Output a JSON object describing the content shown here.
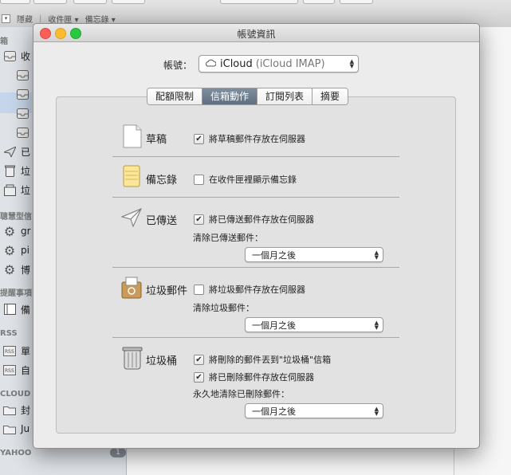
{
  "background": {
    "favorites": [
      "隱藏",
      "收件匣",
      "備忘錄"
    ],
    "sidebar": {
      "items": [
        {
          "label": "箱",
          "kind": "header"
        },
        {
          "label": "收",
          "icon": "inbox-icon"
        },
        {
          "label": "",
          "icon": "inbox-icon"
        },
        {
          "label": "",
          "icon": "inbox-icon"
        },
        {
          "label": "",
          "icon": "inbox-icon"
        },
        {
          "label": "",
          "icon": "inbox-icon"
        },
        {
          "label": "已",
          "icon": "paper-plane-icon"
        },
        {
          "label": "垃",
          "icon": "trash-icon"
        },
        {
          "label": "垃",
          "icon": "junk-icon"
        },
        {
          "label": "聰慧型信",
          "kind": "header"
        },
        {
          "label": "gr",
          "icon": "gear-icon"
        },
        {
          "label": "pi",
          "icon": "gear-icon"
        },
        {
          "label": "博",
          "icon": "gear-icon"
        },
        {
          "label": "提醒事項",
          "kind": "header"
        },
        {
          "label": "備",
          "icon": "notes-icon"
        },
        {
          "label": "RSS",
          "kind": "header"
        },
        {
          "label": "單",
          "icon": "rss-icon"
        },
        {
          "label": "自",
          "icon": "rss-icon"
        },
        {
          "label": "CLOUD",
          "kind": "header"
        },
        {
          "label": "封",
          "icon": "folder-icon"
        },
        {
          "label": "Ju",
          "icon": "folder-icon"
        },
        {
          "label": "YAHOO",
          "kind": "header"
        }
      ],
      "badge": "1"
    }
  },
  "dialog": {
    "title": "帳號資訊",
    "account_label": "帳號：",
    "account_value": "iCloud",
    "account_detail": "(iCloud IMAP)",
    "tabs": [
      {
        "label": "配額限制",
        "active": false
      },
      {
        "label": "信箱動作",
        "active": true
      },
      {
        "label": "訂閱列表",
        "active": false
      },
      {
        "label": "摘要",
        "active": false
      }
    ],
    "sections": {
      "drafts": {
        "label": "草稿",
        "icon": "document-icon",
        "option": {
          "label": "將草稿郵件存放在伺服器",
          "checked": true
        }
      },
      "notes": {
        "label": "備忘錄",
        "icon": "notepad-icon",
        "option": {
          "label": "在收件匣裡顯示備忘錄",
          "checked": false
        }
      },
      "sent": {
        "label": "已傳送",
        "icon": "paper-plane-icon",
        "option": {
          "label": "將已傳送郵件存放在伺服器",
          "checked": true
        },
        "erase_label": "清除已傳送郵件：",
        "erase_value": "一個月之後"
      },
      "junk": {
        "label": "垃圾郵件",
        "icon": "junk-mail-icon",
        "option": {
          "label": "將垃圾郵件存放在伺服器",
          "checked": false
        },
        "erase_label": "清除垃圾郵件：",
        "erase_value": "一個月之後"
      },
      "trash": {
        "label": "垃圾桶",
        "icon": "trash-can-icon",
        "option1": {
          "label": "將刪除的郵件丟到\"垃圾桶\"信箱",
          "checked": true
        },
        "option2": {
          "label": "將已刪除郵件存放在伺服器",
          "checked": true
        },
        "erase_label": "永久地清除已刪除郵件：",
        "erase_value": "一個月之後"
      }
    }
  }
}
